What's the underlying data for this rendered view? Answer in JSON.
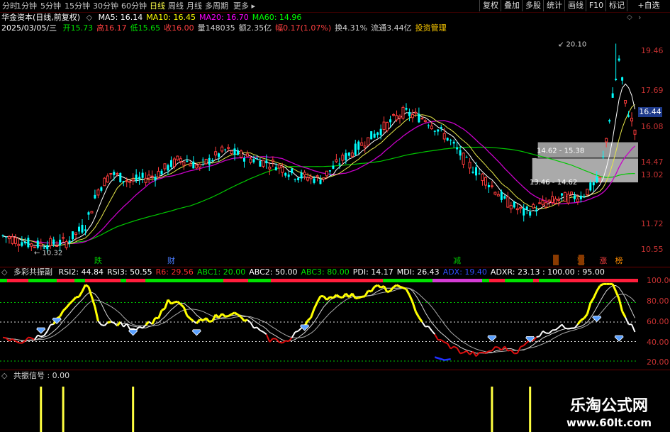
{
  "timeframes": [
    "分时",
    "1分钟",
    "5分钟",
    "15分钟",
    "30分钟",
    "60分钟",
    "日线",
    "周线",
    "月线",
    "多周期",
    "更多"
  ],
  "active_timeframe": "日线",
  "right_buttons": [
    "复权",
    "叠加",
    "多股",
    "统计",
    "画线",
    "F10",
    "标记",
    "+自选"
  ],
  "stock": {
    "title": "华金资本(日线,前复权)",
    "date": "2025/03/05/三",
    "ma": [
      {
        "label": "MA5: 16.14",
        "color": "#ffffff"
      },
      {
        "label": "MA10: 16.45",
        "color": "#ffff00"
      },
      {
        "label": "MA20: 16.70",
        "color": "#ff00ff"
      },
      {
        "label": "MA60: 14.96",
        "color": "#00ff00"
      }
    ],
    "quote": [
      {
        "label": "开15.73",
        "color": "#00e000"
      },
      {
        "label": "高16.17",
        "color": "#ff4040"
      },
      {
        "label": "低15.65",
        "color": "#00e000"
      },
      {
        "label": "收16.00",
        "color": "#ff4040"
      },
      {
        "label": "量148035",
        "color": "#d0d0d0"
      },
      {
        "label": "额2.35亿",
        "color": "#d0d0d0"
      },
      {
        "label": "幅0.17(1.07%)",
        "color": "#ff4040"
      },
      {
        "label": "换4.31%",
        "color": "#d0d0d0"
      },
      {
        "label": "流通3.44亿",
        "color": "#d0d0d0"
      },
      {
        "label": "投资管理",
        "color": "#ffcc00"
      }
    ]
  },
  "price_axis": [
    "19.46",
    "17.69",
    "16.08",
    "14.47",
    "13.02",
    "11.72",
    "10.55"
  ],
  "current_price": "16.44",
  "price_notes": {
    "high": "20.10",
    "low": "10.32",
    "zone_upper": "14.62 - 15.38",
    "zone_lower": "13.46 - 14.62"
  },
  "signal_tags": [
    {
      "text": "跌",
      "color": "#00c800",
      "x_index": 30
    },
    {
      "text": "财",
      "color": "#4a7cff",
      "x_index": 53
    },
    {
      "text": "减",
      "color": "#00c800",
      "x_index": 143
    },
    {
      "text": "预",
      "color": "#ff8c00",
      "x_index": 182
    },
    {
      "text": "涨",
      "color": "#ff4040",
      "x_index": 189
    },
    {
      "text": "榜",
      "color": "#ff8c00",
      "x_index": 194
    }
  ],
  "indicator": {
    "name": "多彩共振副",
    "values": [
      {
        "label": "RSI2: 44.84",
        "color": "#ffffff"
      },
      {
        "label": "RSI3: 50.55",
        "color": "#ffffff"
      },
      {
        "label": "R6: 29.56",
        "color": "#ff3030"
      },
      {
        "label": "ABC1: 20.00",
        "color": "#00e000"
      },
      {
        "label": "ABC2: 50.00",
        "color": "#ffffff"
      },
      {
        "label": "ABC3: 80.00",
        "color": "#00e000"
      },
      {
        "label": "PDI: 14.17",
        "color": "#ffffff"
      },
      {
        "label": "MDI: 26.43",
        "color": "#ffffff"
      },
      {
        "label": "ADX: 19.40",
        "color": "#3050ff"
      },
      {
        "label": "ADXR: 23.13 : 100.00 : 95.00",
        "color": "#ffffff"
      }
    ],
    "axis": [
      "100.00",
      "80.00",
      "60.00",
      "40.00",
      "20.00"
    ]
  },
  "signal": {
    "name": "共振信号",
    "value": ": 0.00"
  },
  "watermark": {
    "title": "乐淘公式网",
    "url": "www.60lt.com"
  },
  "colors": {
    "up": "#ff3c3c",
    "down": "#00ffff",
    "axis": "#c83232",
    "rsi_high": "#ffff00",
    "rsi_low": "#e01010",
    "adx": "#2030ff"
  }
}
